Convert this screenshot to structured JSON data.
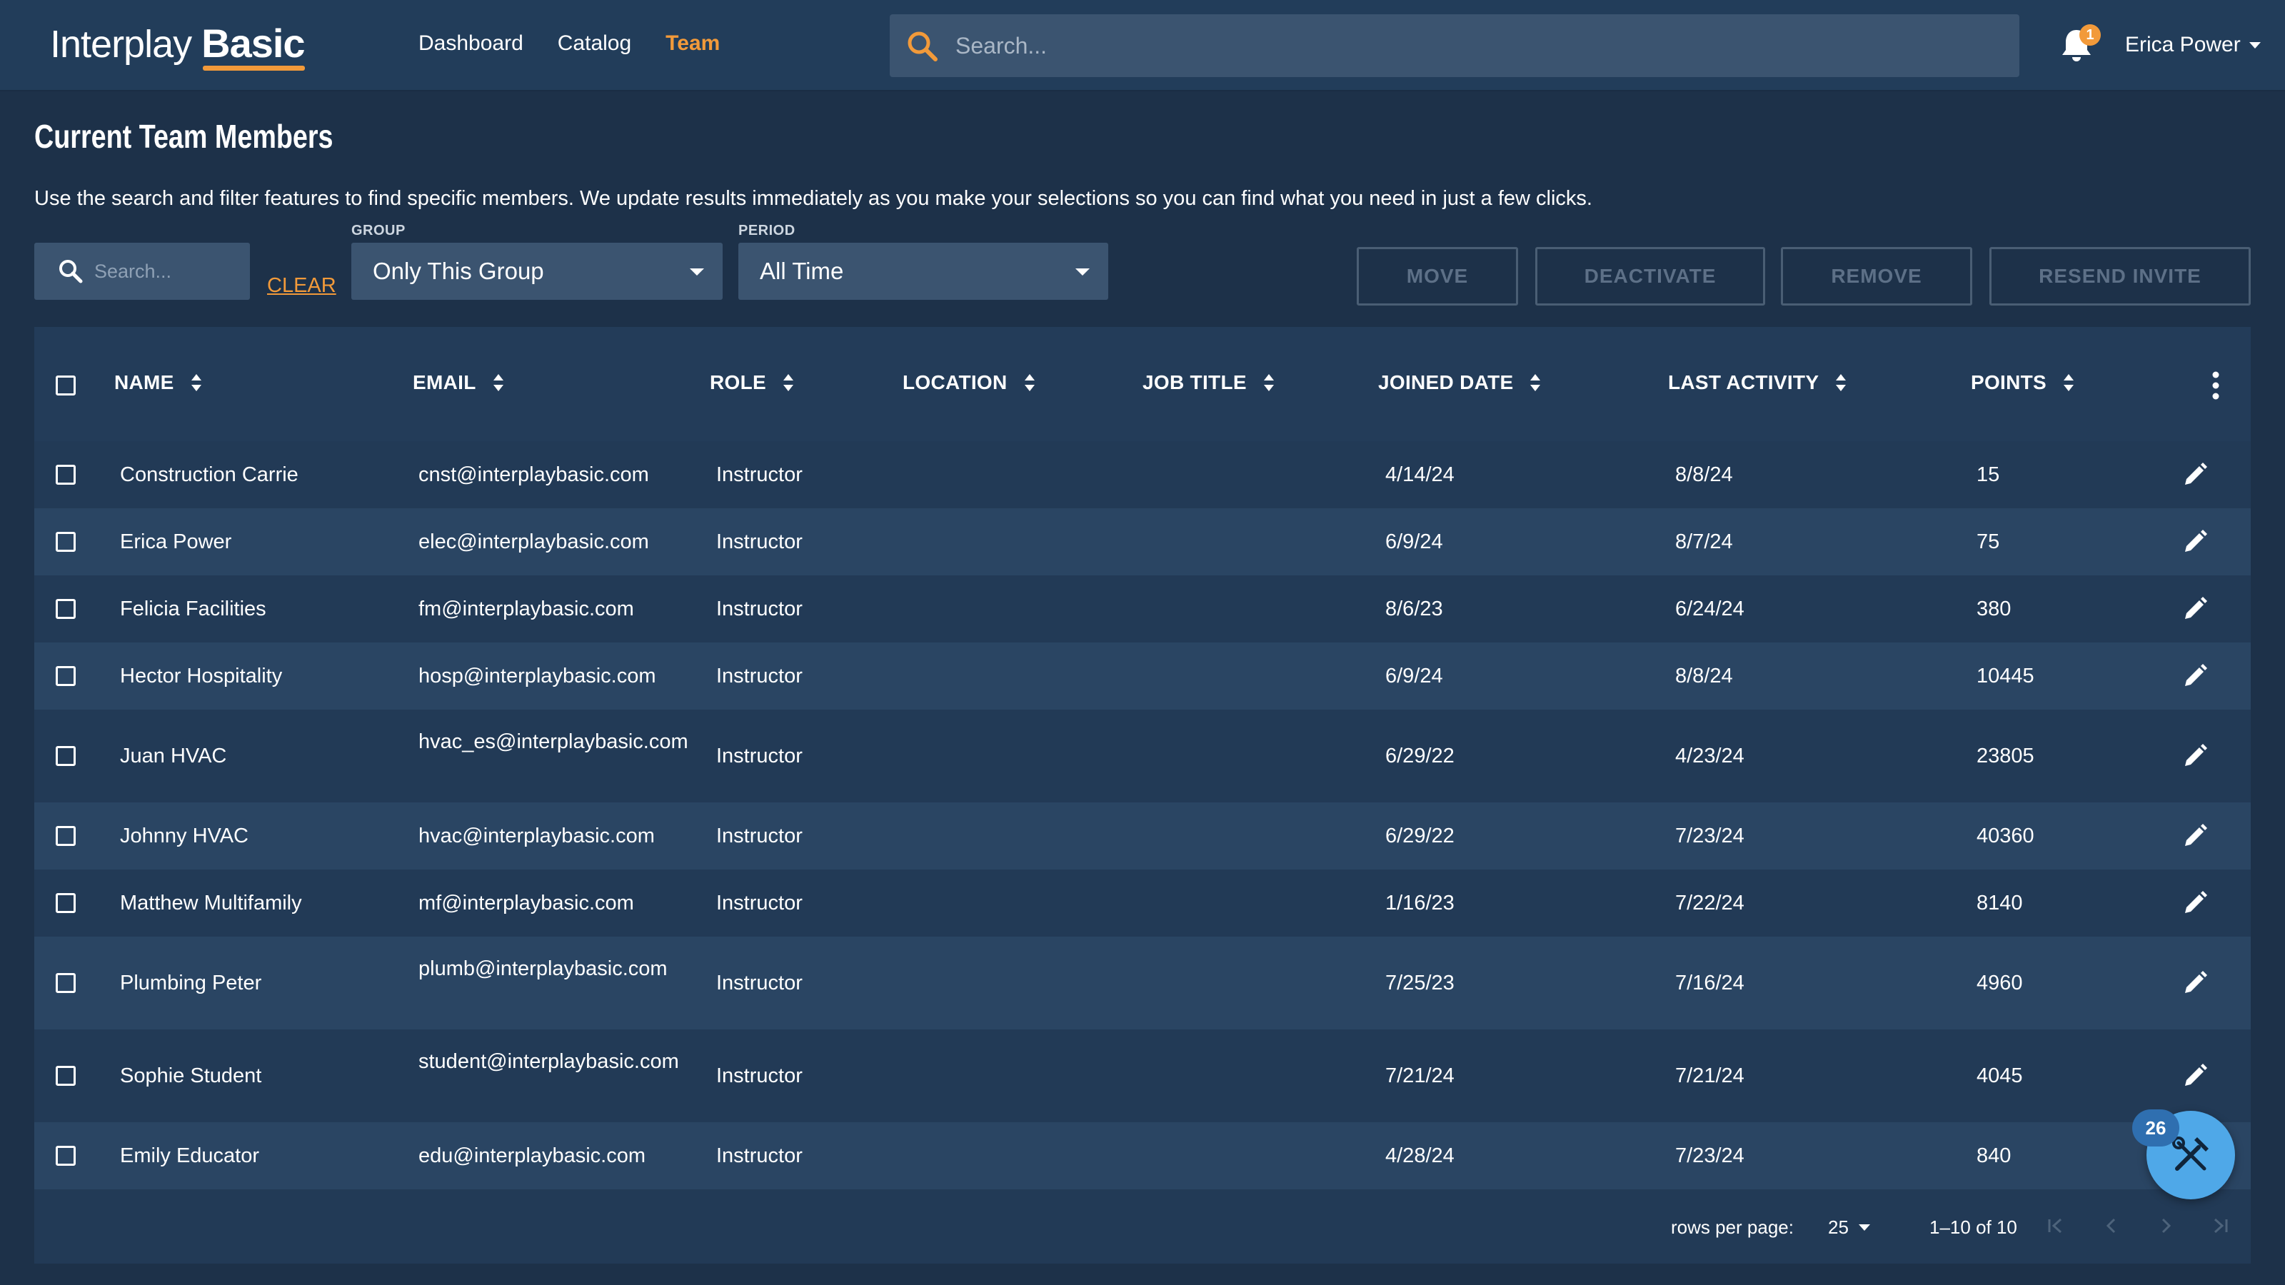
{
  "brand": {
    "name_light": "Interplay",
    "name_bold": "Basic",
    "accent": "#f29a3a"
  },
  "nav": [
    {
      "label": "Dashboard",
      "active": false
    },
    {
      "label": "Catalog",
      "active": false
    },
    {
      "label": "Team",
      "active": true
    }
  ],
  "header": {
    "search_placeholder": "Search...",
    "notifications_count": "1",
    "user_name": "Erica Power"
  },
  "page": {
    "title": "Current Team Members",
    "description": "Use the search and filter features to find specific members. We update results immediately as you make your selections so you can find what you need in just a few clicks."
  },
  "filters": {
    "search_placeholder": "Search...",
    "clear_label": "CLEAR",
    "group_label": "GROUP",
    "group_value": "Only This Group",
    "period_label": "PERIOD",
    "period_value": "All Time"
  },
  "actions": [
    "MOVE",
    "DEACTIVATE",
    "REMOVE",
    "RESEND INVITE"
  ],
  "table": {
    "columns": [
      "NAME",
      "EMAIL",
      "ROLE",
      "LOCATION",
      "JOB TITLE",
      "JOINED DATE",
      "LAST ACTIVITY",
      "POINTS"
    ],
    "rows": [
      {
        "name": "Construction Carrie",
        "email": "cnst@interplaybasic.com",
        "role": "Instructor",
        "location": "",
        "job_title": "",
        "joined": "4/14/24",
        "last_activity": "8/8/24",
        "points": "15"
      },
      {
        "name": "Erica Power",
        "email": "elec@interplaybasic.com",
        "role": "Instructor",
        "location": "",
        "job_title": "",
        "joined": "6/9/24",
        "last_activity": "8/7/24",
        "points": "75"
      },
      {
        "name": "Felicia Facilities",
        "email": "fm@interplaybasic.com",
        "role": "Instructor",
        "location": "",
        "job_title": "",
        "joined": "8/6/23",
        "last_activity": "6/24/24",
        "points": "380"
      },
      {
        "name": "Hector Hospitality",
        "email": "hosp@interplaybasic.com",
        "role": "Instructor",
        "location": "",
        "job_title": "",
        "joined": "6/9/24",
        "last_activity": "8/8/24",
        "points": "10445"
      },
      {
        "name": "Juan HVAC",
        "email": "hvac_es@interplaybasic.com",
        "role": "Instructor",
        "location": "",
        "job_title": "",
        "joined": "6/29/22",
        "last_activity": "4/23/24",
        "points": "23805"
      },
      {
        "name": "Johnny HVAC",
        "email": "hvac@interplaybasic.com",
        "role": "Instructor",
        "location": "",
        "job_title": "",
        "joined": "6/29/22",
        "last_activity": "7/23/24",
        "points": "40360"
      },
      {
        "name": "Matthew Multifamily",
        "email": "mf@interplaybasic.com",
        "role": "Instructor",
        "location": "",
        "job_title": "",
        "joined": "1/16/23",
        "last_activity": "7/22/24",
        "points": "8140"
      },
      {
        "name": "Plumbing Peter",
        "email": "plumb@interplaybasic.com",
        "role": "Instructor",
        "location": "",
        "job_title": "",
        "joined": "7/25/23",
        "last_activity": "7/16/24",
        "points": "4960"
      },
      {
        "name": "Sophie Student",
        "email": "student@interplaybasic.com",
        "role": "Instructor",
        "location": "",
        "job_title": "",
        "joined": "7/21/24",
        "last_activity": "7/21/24",
        "points": "4045"
      },
      {
        "name": "Emily Educator",
        "email": "edu@interplaybasic.com",
        "role": "Instructor",
        "location": "",
        "job_title": "",
        "joined": "4/28/24",
        "last_activity": "7/23/24",
        "points": "840"
      }
    ]
  },
  "pagination": {
    "rows_per_page_label": "rows per page:",
    "rows_per_page_value": "25",
    "range": "1–10 of 10"
  },
  "fab": {
    "badge": "26",
    "icon": "tools-icon"
  },
  "icons": {
    "search": "search-icon",
    "bell": "bell-icon",
    "sort": "sort-icon",
    "edit": "pencil-icon",
    "more": "kebab-icon",
    "pager": [
      "first-page-icon",
      "prev-page-icon",
      "next-page-icon",
      "last-page-icon"
    ]
  }
}
